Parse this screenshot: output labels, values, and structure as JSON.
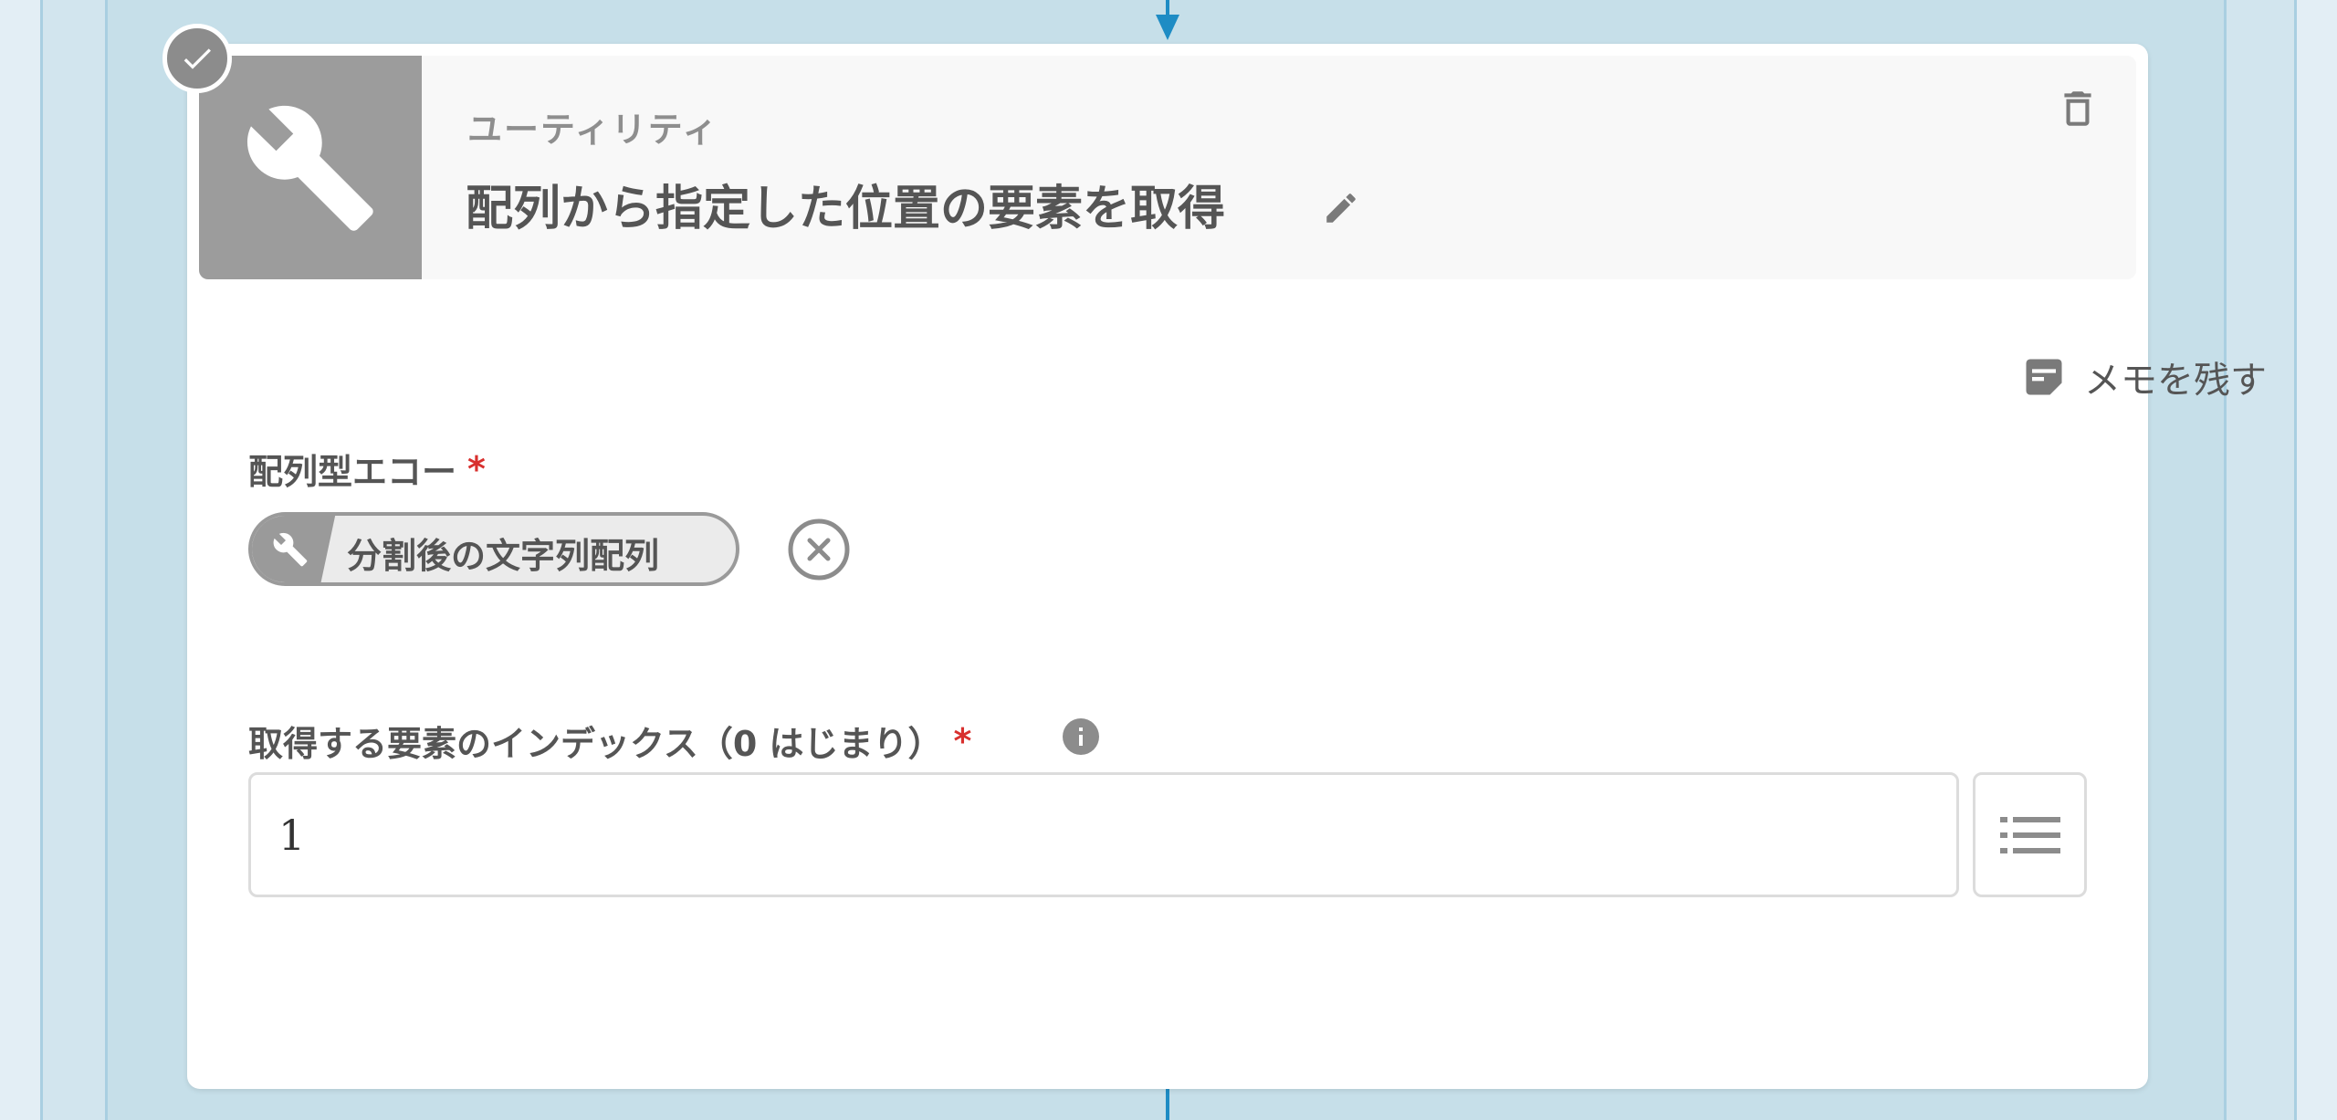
{
  "card": {
    "category": "ユーティリティ",
    "title": "配列から指定した位置の要素を取得"
  },
  "memo": {
    "label": "メモを残す"
  },
  "fields": {
    "array_echo": {
      "label": "配列型エコー",
      "required_mark": "*",
      "chip_label": "分割後の文字列配列"
    },
    "index": {
      "label": "取得する要素のインデックス（0 はじまり）",
      "required_mark": "*",
      "value": "1"
    }
  },
  "icons": {
    "header": "tools-icon",
    "status": "check-icon",
    "edit": "pencil-icon",
    "delete": "trash-icon",
    "memo": "note-icon",
    "chip": "tools-icon",
    "remove": "close-circle-icon",
    "info": "info-icon",
    "list": "list-icon"
  },
  "colors": {
    "connector": "#1e8cc4",
    "required": "#d8302e",
    "icon_gray": "#9c9c9c"
  }
}
